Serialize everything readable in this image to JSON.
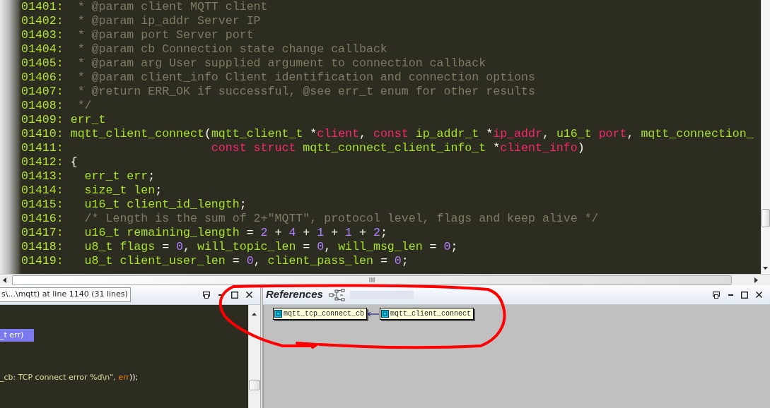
{
  "editor": {
    "lines": [
      {
        "number": "01401:",
        "tokens": [
          {
            "text": "  * @param client MQTT client",
            "kind": "comment"
          }
        ]
      },
      {
        "number": "01402:",
        "tokens": [
          {
            "text": "  * @param ip_addr Server IP",
            "kind": "comment"
          }
        ]
      },
      {
        "number": "01403:",
        "tokens": [
          {
            "text": "  * @param port Server port",
            "kind": "comment"
          }
        ]
      },
      {
        "number": "01404:",
        "tokens": [
          {
            "text": "  * @param cb Connection state change callback",
            "kind": "comment"
          }
        ]
      },
      {
        "number": "01405:",
        "tokens": [
          {
            "text": "  * @param arg User supplied argument to connection callback",
            "kind": "comment"
          }
        ]
      },
      {
        "number": "01406:",
        "tokens": [
          {
            "text": "  * @param client_info Client identification and connection options",
            "kind": "comment"
          }
        ]
      },
      {
        "number": "01407:",
        "tokens": [
          {
            "text": "  * @return ERR_OK if successful, @see err_t enum for other results",
            "kind": "comment"
          }
        ]
      },
      {
        "number": "01408:",
        "tokens": [
          {
            "text": "  */",
            "kind": "comment"
          }
        ]
      },
      {
        "number": "01409:",
        "tokens": [
          {
            "text": " err_t",
            "kind": "type"
          }
        ]
      },
      {
        "number": "01410:",
        "tokens": [
          {
            "text": " mqtt_client_connect",
            "kind": "type"
          },
          {
            "text": "(",
            "kind": "punct"
          },
          {
            "text": "mqtt_client_t",
            "kind": "type"
          },
          {
            "text": " *",
            "kind": "punct"
          },
          {
            "text": "client",
            "kind": "param"
          },
          {
            "text": ", ",
            "kind": "punct"
          },
          {
            "text": "const",
            "kind": "param"
          },
          {
            "text": " ip_addr_t",
            "kind": "type"
          },
          {
            "text": " *",
            "kind": "punct"
          },
          {
            "text": "ip_addr",
            "kind": "param"
          },
          {
            "text": ", ",
            "kind": "punct"
          },
          {
            "text": "u16_t",
            "kind": "type"
          },
          {
            "text": " port",
            "kind": "param"
          },
          {
            "text": ", ",
            "kind": "punct"
          },
          {
            "text": "mqtt_connection_",
            "kind": "type"
          }
        ]
      },
      {
        "number": "01411:",
        "tokens": [
          {
            "text": "                     const struct",
            "kind": "param"
          },
          {
            "text": " mqtt_connect_client_info_t",
            "kind": "type"
          },
          {
            "text": " *",
            "kind": "punct"
          },
          {
            "text": "client_info",
            "kind": "param"
          },
          {
            "text": ")",
            "kind": "punct"
          }
        ]
      },
      {
        "number": "01412:",
        "tokens": [
          {
            "text": " {",
            "kind": "punct"
          }
        ]
      },
      {
        "number": "01413:",
        "tokens": [
          {
            "text": "   err_t err",
            "kind": "type"
          },
          {
            "text": ";",
            "kind": "punct"
          }
        ]
      },
      {
        "number": "01414:",
        "tokens": [
          {
            "text": "   size_t len",
            "kind": "type"
          },
          {
            "text": ";",
            "kind": "punct"
          }
        ]
      },
      {
        "number": "01415:",
        "tokens": [
          {
            "text": "   u16_t client_id_length",
            "kind": "type"
          },
          {
            "text": ";",
            "kind": "punct"
          }
        ]
      },
      {
        "number": "01416:",
        "tokens": [
          {
            "text": "   /* Length is the sum of 2+\"MQTT\", protocol level, flags and keep alive */",
            "kind": "comment"
          }
        ]
      },
      {
        "number": "01417:",
        "tokens": [
          {
            "text": "   u16_t remaining_length",
            "kind": "type"
          },
          {
            "text": " = ",
            "kind": "punct"
          },
          {
            "text": "2",
            "kind": "number"
          },
          {
            "text": " + ",
            "kind": "punct"
          },
          {
            "text": "4",
            "kind": "number"
          },
          {
            "text": " + ",
            "kind": "punct"
          },
          {
            "text": "1",
            "kind": "number"
          },
          {
            "text": " + ",
            "kind": "punct"
          },
          {
            "text": "1",
            "kind": "number"
          },
          {
            "text": " + ",
            "kind": "punct"
          },
          {
            "text": "2",
            "kind": "number"
          },
          {
            "text": ";",
            "kind": "punct"
          }
        ]
      },
      {
        "number": "01418:",
        "tokens": [
          {
            "text": "   u8_t flags",
            "kind": "type"
          },
          {
            "text": " = ",
            "kind": "punct"
          },
          {
            "text": "0",
            "kind": "number"
          },
          {
            "text": ", ",
            "kind": "punct"
          },
          {
            "text": "will_topic_len",
            "kind": "type"
          },
          {
            "text": " = ",
            "kind": "punct"
          },
          {
            "text": "0",
            "kind": "number"
          },
          {
            "text": ", ",
            "kind": "punct"
          },
          {
            "text": "will_msg_len",
            "kind": "type"
          },
          {
            "text": " = ",
            "kind": "punct"
          },
          {
            "text": "0",
            "kind": "number"
          },
          {
            "text": ";",
            "kind": "punct"
          }
        ]
      },
      {
        "number": "01419:",
        "tokens": [
          {
            "text": "   u8_t client_user_len",
            "kind": "type"
          },
          {
            "text": " = ",
            "kind": "punct"
          },
          {
            "text": "0",
            "kind": "number"
          },
          {
            "text": ", ",
            "kind": "punct"
          },
          {
            "text": "client_pass_len",
            "kind": "type"
          },
          {
            "text": " = ",
            "kind": "punct"
          },
          {
            "text": "0",
            "kind": "number"
          },
          {
            "text": ";",
            "kind": "punct"
          }
        ]
      }
    ]
  },
  "output_panel": {
    "tab": "s\\...\\mqtt) at line 1140 (31 lines)",
    "lines": [
      {
        "selected": true,
        "tokens": [
          {
            "text": "_t err)",
            "kind": "plain"
          }
        ]
      },
      {
        "selected": false,
        "tokens": [
          {
            "text": "_cb: TCP connect error %d\\n\", ",
            "kind": "string"
          },
          {
            "text": "err",
            "kind": "var"
          },
          {
            "text": "));",
            "kind": "punct"
          }
        ]
      }
    ]
  },
  "references": {
    "title": "References",
    "nodes": [
      {
        "label": "mqtt_tcp_connect_cb"
      },
      {
        "label": "mqtt_client_connect"
      }
    ]
  }
}
